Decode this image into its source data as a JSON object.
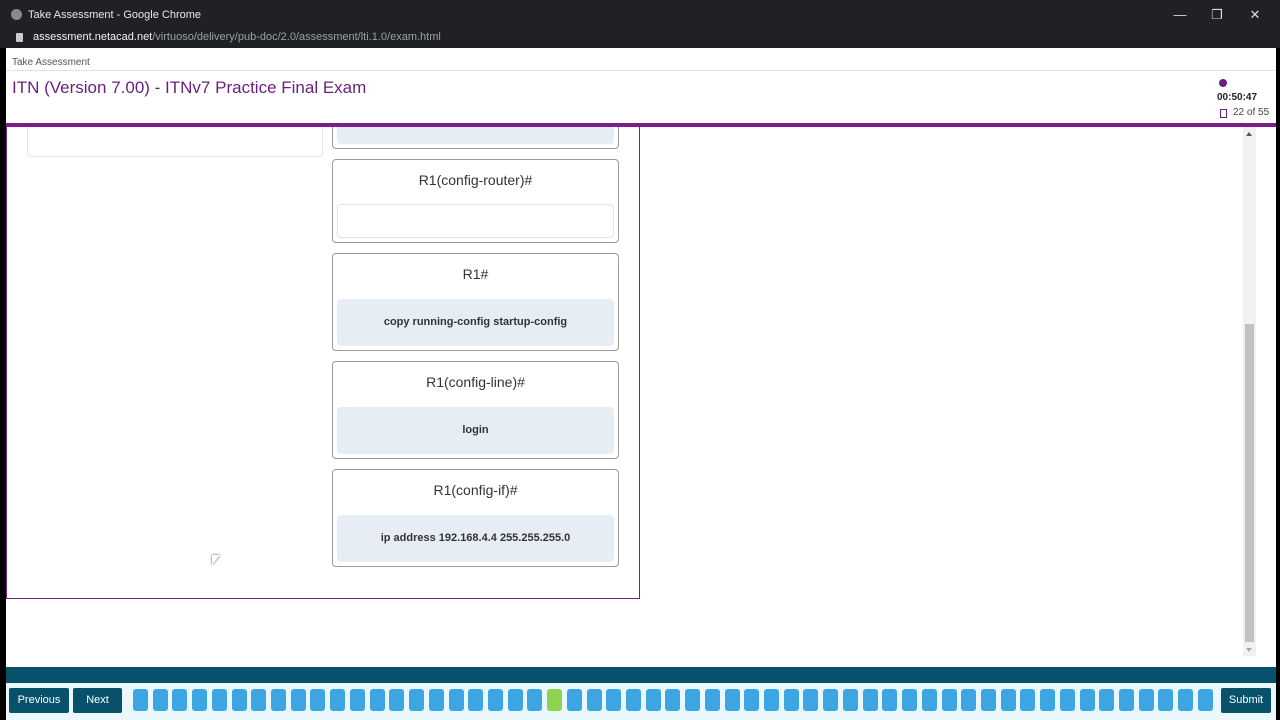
{
  "browser": {
    "window_title": "Take Assessment - Google Chrome",
    "url_domain": "assessment.netacad.net",
    "url_path": "/virtuoso/delivery/pub-doc/2.0/assessment/lti.1.0/exam.html",
    "window_controls": [
      "minimize",
      "restore",
      "close"
    ]
  },
  "header": {
    "breadcrumb": "Take Assessment",
    "exam_title": "ITN (Version 7.00) - ITNv7 Practice Final Exam",
    "timer": "00:50:47",
    "question_counter": "22 of 55",
    "accent_color": "#7b1e8c"
  },
  "question": {
    "cards": [
      {
        "prompt": "",
        "answer": "",
        "state": "filled-partial"
      },
      {
        "prompt": "R1(config-router)#",
        "answer": "",
        "state": "empty"
      },
      {
        "prompt": "R1#",
        "answer": "copy running-config startup-config",
        "state": "filled"
      },
      {
        "prompt": "R1(config-line)#",
        "answer": "login",
        "state": "filled"
      },
      {
        "prompt": "R1(config-if)#",
        "answer": "ip address 192.168.4.4 255.255.255.0",
        "state": "filled"
      }
    ]
  },
  "footer": {
    "previous_label": "Previous",
    "next_label": "Next",
    "submit_label": "Submit",
    "total_questions": 55,
    "current_question": 22,
    "question_color": "#3ea5e3",
    "current_color": "#8fd150"
  }
}
